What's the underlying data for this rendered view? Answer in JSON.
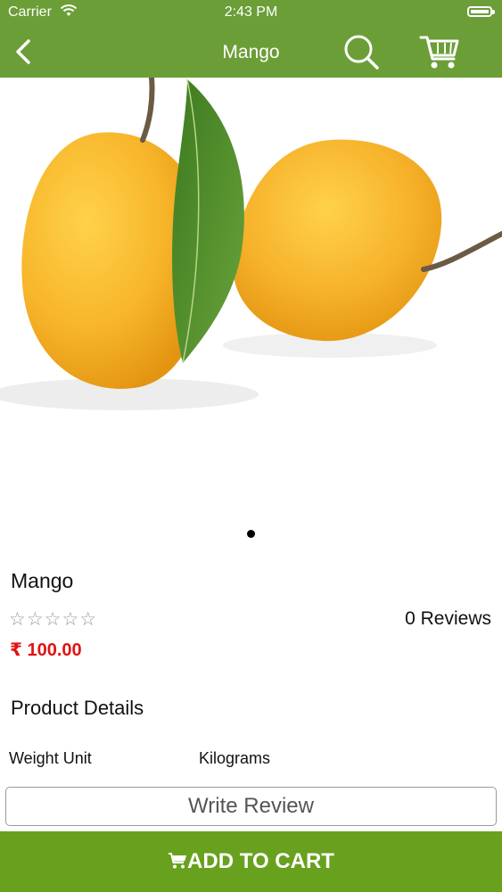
{
  "status_bar": {
    "carrier": "Carrier",
    "time": "2:43 PM"
  },
  "nav": {
    "title": "Mango"
  },
  "product": {
    "name": "Mango",
    "rating": {
      "value": 0,
      "max": 5,
      "stars_display": "☆☆☆☆☆"
    },
    "reviews": "0 Reviews",
    "price": "₹ 100.00",
    "image_pager": {
      "current": 1,
      "total": 1
    }
  },
  "details": {
    "title": "Product Details",
    "rows": [
      {
        "label": "Weight Unit",
        "value": "Kilograms"
      }
    ]
  },
  "actions": {
    "write_review": "Write Review",
    "add_to_cart": "ADD TO CART"
  },
  "colors": {
    "header": "#6b9e37",
    "add_to_cart": "#68a11e",
    "price": "#e01313"
  },
  "icons": [
    "back-icon",
    "search-icon",
    "cart-icon",
    "wifi-icon",
    "battery-icon"
  ]
}
